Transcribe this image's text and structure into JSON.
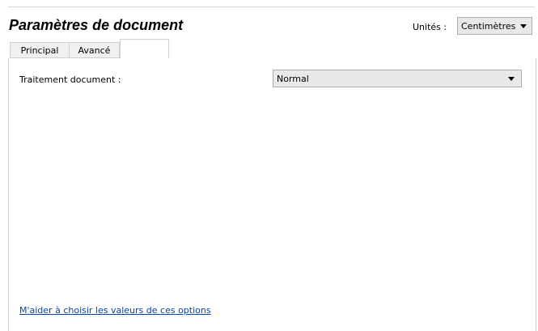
{
  "header": {
    "title": "Paramètres de document",
    "units_label": "Unités :",
    "units_value": "Centimètres"
  },
  "tabs": [
    {
      "label": "Principal",
      "selected": false
    },
    {
      "label": "Avancé",
      "selected": false
    },
    {
      "label": "",
      "selected": true
    }
  ],
  "form": {
    "processing_label": "Traitement document :",
    "processing_value": "Normal"
  },
  "help_link": "M'aider à choisir les valeurs de ces options",
  "icons": {
    "dropdown": "chevron-down-icon"
  },
  "colors": {
    "link": "#0645ad",
    "select_bg": "#e9e9e9",
    "tab_bg": "#f0f0f0",
    "border": "#d0d0d0"
  }
}
